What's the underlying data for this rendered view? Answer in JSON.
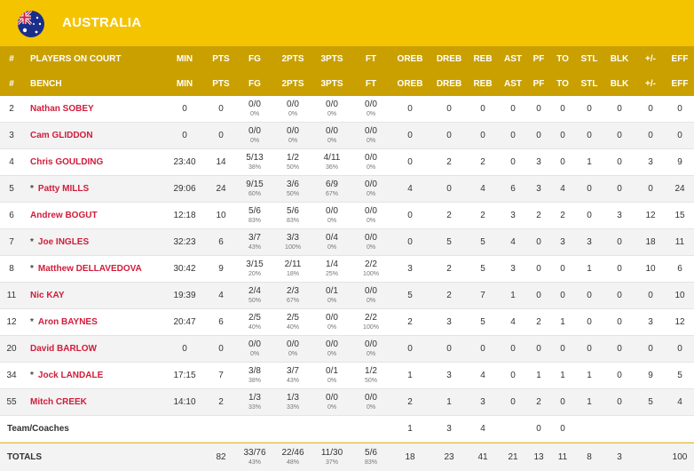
{
  "team": {
    "name": "AUSTRALIA",
    "flag_icon": "australia-flag-icon",
    "colors": {
      "header": "#f5c400",
      "subheader": "#c9a000",
      "name": "#d11c3a"
    }
  },
  "headers": {
    "court": [
      "#",
      "PLAYERS ON COURT",
      "MIN",
      "PTS",
      "FG",
      "2PTS",
      "3PTS",
      "FT",
      "OREB",
      "DREB",
      "REB",
      "AST",
      "PF",
      "TO",
      "STL",
      "BLK",
      "+/-",
      "EFF"
    ],
    "bench": [
      "#",
      "BENCH",
      "MIN",
      "PTS",
      "FG",
      "2PTS",
      "3PTS",
      "FT",
      "OREB",
      "DREB",
      "REB",
      "AST",
      "PF",
      "TO",
      "STL",
      "BLK",
      "+/-",
      "EFF"
    ]
  },
  "players": [
    {
      "num": "2",
      "starter": false,
      "name": "Nathan SOBEY",
      "min": "0",
      "pts": "0",
      "fg": "0/0",
      "fg_pct": "0%",
      "p2": "0/0",
      "p2_pct": "0%",
      "p3": "0/0",
      "p3_pct": "0%",
      "ft": "0/0",
      "ft_pct": "0%",
      "oreb": "0",
      "dreb": "0",
      "reb": "0",
      "ast": "0",
      "pf": "0",
      "to": "0",
      "stl": "0",
      "blk": "0",
      "pm": "0",
      "eff": "0"
    },
    {
      "num": "3",
      "starter": false,
      "name": "Cam GLIDDON",
      "min": "0",
      "pts": "0",
      "fg": "0/0",
      "fg_pct": "0%",
      "p2": "0/0",
      "p2_pct": "0%",
      "p3": "0/0",
      "p3_pct": "0%",
      "ft": "0/0",
      "ft_pct": "0%",
      "oreb": "0",
      "dreb": "0",
      "reb": "0",
      "ast": "0",
      "pf": "0",
      "to": "0",
      "stl": "0",
      "blk": "0",
      "pm": "0",
      "eff": "0"
    },
    {
      "num": "4",
      "starter": false,
      "name": "Chris GOULDING",
      "min": "23:40",
      "pts": "14",
      "fg": "5/13",
      "fg_pct": "38%",
      "p2": "1/2",
      "p2_pct": "50%",
      "p3": "4/11",
      "p3_pct": "36%",
      "ft": "0/0",
      "ft_pct": "0%",
      "oreb": "0",
      "dreb": "2",
      "reb": "2",
      "ast": "0",
      "pf": "3",
      "to": "0",
      "stl": "1",
      "blk": "0",
      "pm": "3",
      "eff": "9"
    },
    {
      "num": "5",
      "starter": true,
      "name": "Patty MILLS",
      "min": "29:06",
      "pts": "24",
      "fg": "9/15",
      "fg_pct": "60%",
      "p2": "3/6",
      "p2_pct": "50%",
      "p3": "6/9",
      "p3_pct": "67%",
      "ft": "0/0",
      "ft_pct": "0%",
      "oreb": "4",
      "dreb": "0",
      "reb": "4",
      "ast": "6",
      "pf": "3",
      "to": "4",
      "stl": "0",
      "blk": "0",
      "pm": "0",
      "eff": "24"
    },
    {
      "num": "6",
      "starter": false,
      "name": "Andrew BOGUT",
      "min": "12:18",
      "pts": "10",
      "fg": "5/6",
      "fg_pct": "83%",
      "p2": "5/6",
      "p2_pct": "83%",
      "p3": "0/0",
      "p3_pct": "0%",
      "ft": "0/0",
      "ft_pct": "0%",
      "oreb": "0",
      "dreb": "2",
      "reb": "2",
      "ast": "3",
      "pf": "2",
      "to": "2",
      "stl": "0",
      "blk": "3",
      "pm": "12",
      "eff": "15"
    },
    {
      "num": "7",
      "starter": true,
      "name": "Joe INGLES",
      "min": "32:23",
      "pts": "6",
      "fg": "3/7",
      "fg_pct": "43%",
      "p2": "3/3",
      "p2_pct": "100%",
      "p3": "0/4",
      "p3_pct": "0%",
      "ft": "0/0",
      "ft_pct": "0%",
      "oreb": "0",
      "dreb": "5",
      "reb": "5",
      "ast": "4",
      "pf": "0",
      "to": "3",
      "stl": "3",
      "blk": "0",
      "pm": "18",
      "eff": "11"
    },
    {
      "num": "8",
      "starter": true,
      "name": "Matthew DELLAVEDOVA",
      "min": "30:42",
      "pts": "9",
      "fg": "3/15",
      "fg_pct": "20%",
      "p2": "2/11",
      "p2_pct": "18%",
      "p3": "1/4",
      "p3_pct": "25%",
      "ft": "2/2",
      "ft_pct": "100%",
      "oreb": "3",
      "dreb": "2",
      "reb": "5",
      "ast": "3",
      "pf": "0",
      "to": "0",
      "stl": "1",
      "blk": "0",
      "pm": "10",
      "eff": "6"
    },
    {
      "num": "11",
      "starter": false,
      "name": "Nic KAY",
      "min": "19:39",
      "pts": "4",
      "fg": "2/4",
      "fg_pct": "50%",
      "p2": "2/3",
      "p2_pct": "67%",
      "p3": "0/1",
      "p3_pct": "0%",
      "ft": "0/0",
      "ft_pct": "0%",
      "oreb": "5",
      "dreb": "2",
      "reb": "7",
      "ast": "1",
      "pf": "0",
      "to": "0",
      "stl": "0",
      "blk": "0",
      "pm": "0",
      "eff": "10"
    },
    {
      "num": "12",
      "starter": true,
      "name": "Aron BAYNES",
      "min": "20:47",
      "pts": "6",
      "fg": "2/5",
      "fg_pct": "40%",
      "p2": "2/5",
      "p2_pct": "40%",
      "p3": "0/0",
      "p3_pct": "0%",
      "ft": "2/2",
      "ft_pct": "100%",
      "oreb": "2",
      "dreb": "3",
      "reb": "5",
      "ast": "4",
      "pf": "2",
      "to": "1",
      "stl": "0",
      "blk": "0",
      "pm": "3",
      "eff": "12"
    },
    {
      "num": "20",
      "starter": false,
      "name": "David BARLOW",
      "min": "0",
      "pts": "0",
      "fg": "0/0",
      "fg_pct": "0%",
      "p2": "0/0",
      "p2_pct": "0%",
      "p3": "0/0",
      "p3_pct": "0%",
      "ft": "0/0",
      "ft_pct": "0%",
      "oreb": "0",
      "dreb": "0",
      "reb": "0",
      "ast": "0",
      "pf": "0",
      "to": "0",
      "stl": "0",
      "blk": "0",
      "pm": "0",
      "eff": "0"
    },
    {
      "num": "34",
      "starter": true,
      "name": "Jock LANDALE",
      "min": "17:15",
      "pts": "7",
      "fg": "3/8",
      "fg_pct": "38%",
      "p2": "3/7",
      "p2_pct": "43%",
      "p3": "0/1",
      "p3_pct": "0%",
      "ft": "1/2",
      "ft_pct": "50%",
      "oreb": "1",
      "dreb": "3",
      "reb": "4",
      "ast": "0",
      "pf": "1",
      "to": "1",
      "stl": "1",
      "blk": "0",
      "pm": "9",
      "eff": "5"
    },
    {
      "num": "55",
      "starter": false,
      "name": "Mitch CREEK",
      "min": "14:10",
      "pts": "2",
      "fg": "1/3",
      "fg_pct": "33%",
      "p2": "1/3",
      "p2_pct": "33%",
      "p3": "0/0",
      "p3_pct": "0%",
      "ft": "0/0",
      "ft_pct": "0%",
      "oreb": "2",
      "dreb": "1",
      "reb": "3",
      "ast": "0",
      "pf": "2",
      "to": "0",
      "stl": "1",
      "blk": "0",
      "pm": "5",
      "eff": "4"
    }
  ],
  "team_coaches": {
    "label": "Team/Coaches",
    "oreb": "1",
    "dreb": "3",
    "reb": "4",
    "pf": "0",
    "to": "0"
  },
  "totals": {
    "label": "TOTALS",
    "pts": "82",
    "fg": "33/76",
    "fg_pct": "43%",
    "p2": "22/46",
    "p2_pct": "48%",
    "p3": "11/30",
    "p3_pct": "37%",
    "ft": "5/6",
    "ft_pct": "83%",
    "oreb": "18",
    "dreb": "23",
    "reb": "41",
    "ast": "21",
    "pf": "13",
    "to": "11",
    "stl": "8",
    "blk": "3",
    "eff": "100"
  }
}
